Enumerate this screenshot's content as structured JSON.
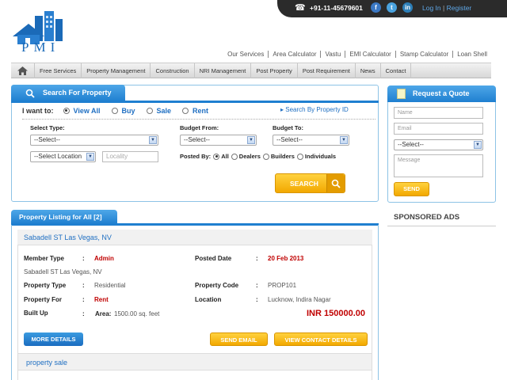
{
  "topbar": {
    "phone": "+91-11-45679601",
    "social": {
      "facebook": "f",
      "twitter": "t",
      "linkedin": "in"
    },
    "login": "Log In",
    "separator": "|",
    "register": "Register"
  },
  "logo": {
    "text": "PMI"
  },
  "sublinks": [
    "Our Services",
    "Area Calculator",
    "Vastu",
    "EMI Calculator",
    "Stamp Calculator",
    "Loan Shell"
  ],
  "nav": [
    "Free Services",
    "Property Management",
    "Construction",
    "NRI Management",
    "Post Property",
    "Post Requirement",
    "News",
    "Contact"
  ],
  "search": {
    "title": "Search For Property",
    "iwant_label": "I want to:",
    "options": [
      "View All",
      "Buy",
      "Sale",
      "Rent"
    ],
    "selected_option": "View All",
    "by_id": "Search By Property ID",
    "select_type_label": "Select Type:",
    "select_type_value": "--Select--",
    "budget_from_label": "Budget From:",
    "budget_from_value": "--Select--",
    "budget_to_label": "Budget To:",
    "budget_to_value": "--Select--",
    "location_value": "--Select Location",
    "locality_placeholder": "Locality",
    "posted_by_label": "Posted By:",
    "posted_by_options": [
      "All",
      "Dealers",
      "Builders",
      "Individuals"
    ],
    "posted_by_selected": "All",
    "search_button": "SEARCH"
  },
  "listing": {
    "title": "Property Listing for All",
    "count": "[2]",
    "items": [
      {
        "heading": "Sabadell ST Las Vegas, NV",
        "member_type_label": "Member Type",
        "member_type": "Admin",
        "posted_date_label": "Posted Date",
        "posted_date": "20 Feb 2013",
        "address": "Sabadell ST Las Vegas, NV",
        "property_type_label": "Property Type",
        "property_type": "Residential",
        "property_code_label": "Property Code",
        "property_code": "PROP101",
        "property_for_label": "Property For",
        "property_for": "Rent",
        "location_label": "Location",
        "location": "Lucknow, Indira Nagar",
        "built_up_label": "Built Up",
        "area_label": "Area:",
        "area": "1500.00 sq. feet",
        "price": "INR 150000.00",
        "more_details": "MORE DETAILS",
        "send_email": "SEND EMAIL",
        "view_contact": "VIEW CONTACT DETAILS"
      },
      {
        "heading": "property sale"
      }
    ]
  },
  "quote": {
    "title": "Request a Quote",
    "name_placeholder": "Name",
    "email_placeholder": "Email",
    "select_value": "--Select--",
    "message_placeholder": "Message",
    "send_button": "SEND"
  },
  "sponsored": "SPONSORED ADS"
}
